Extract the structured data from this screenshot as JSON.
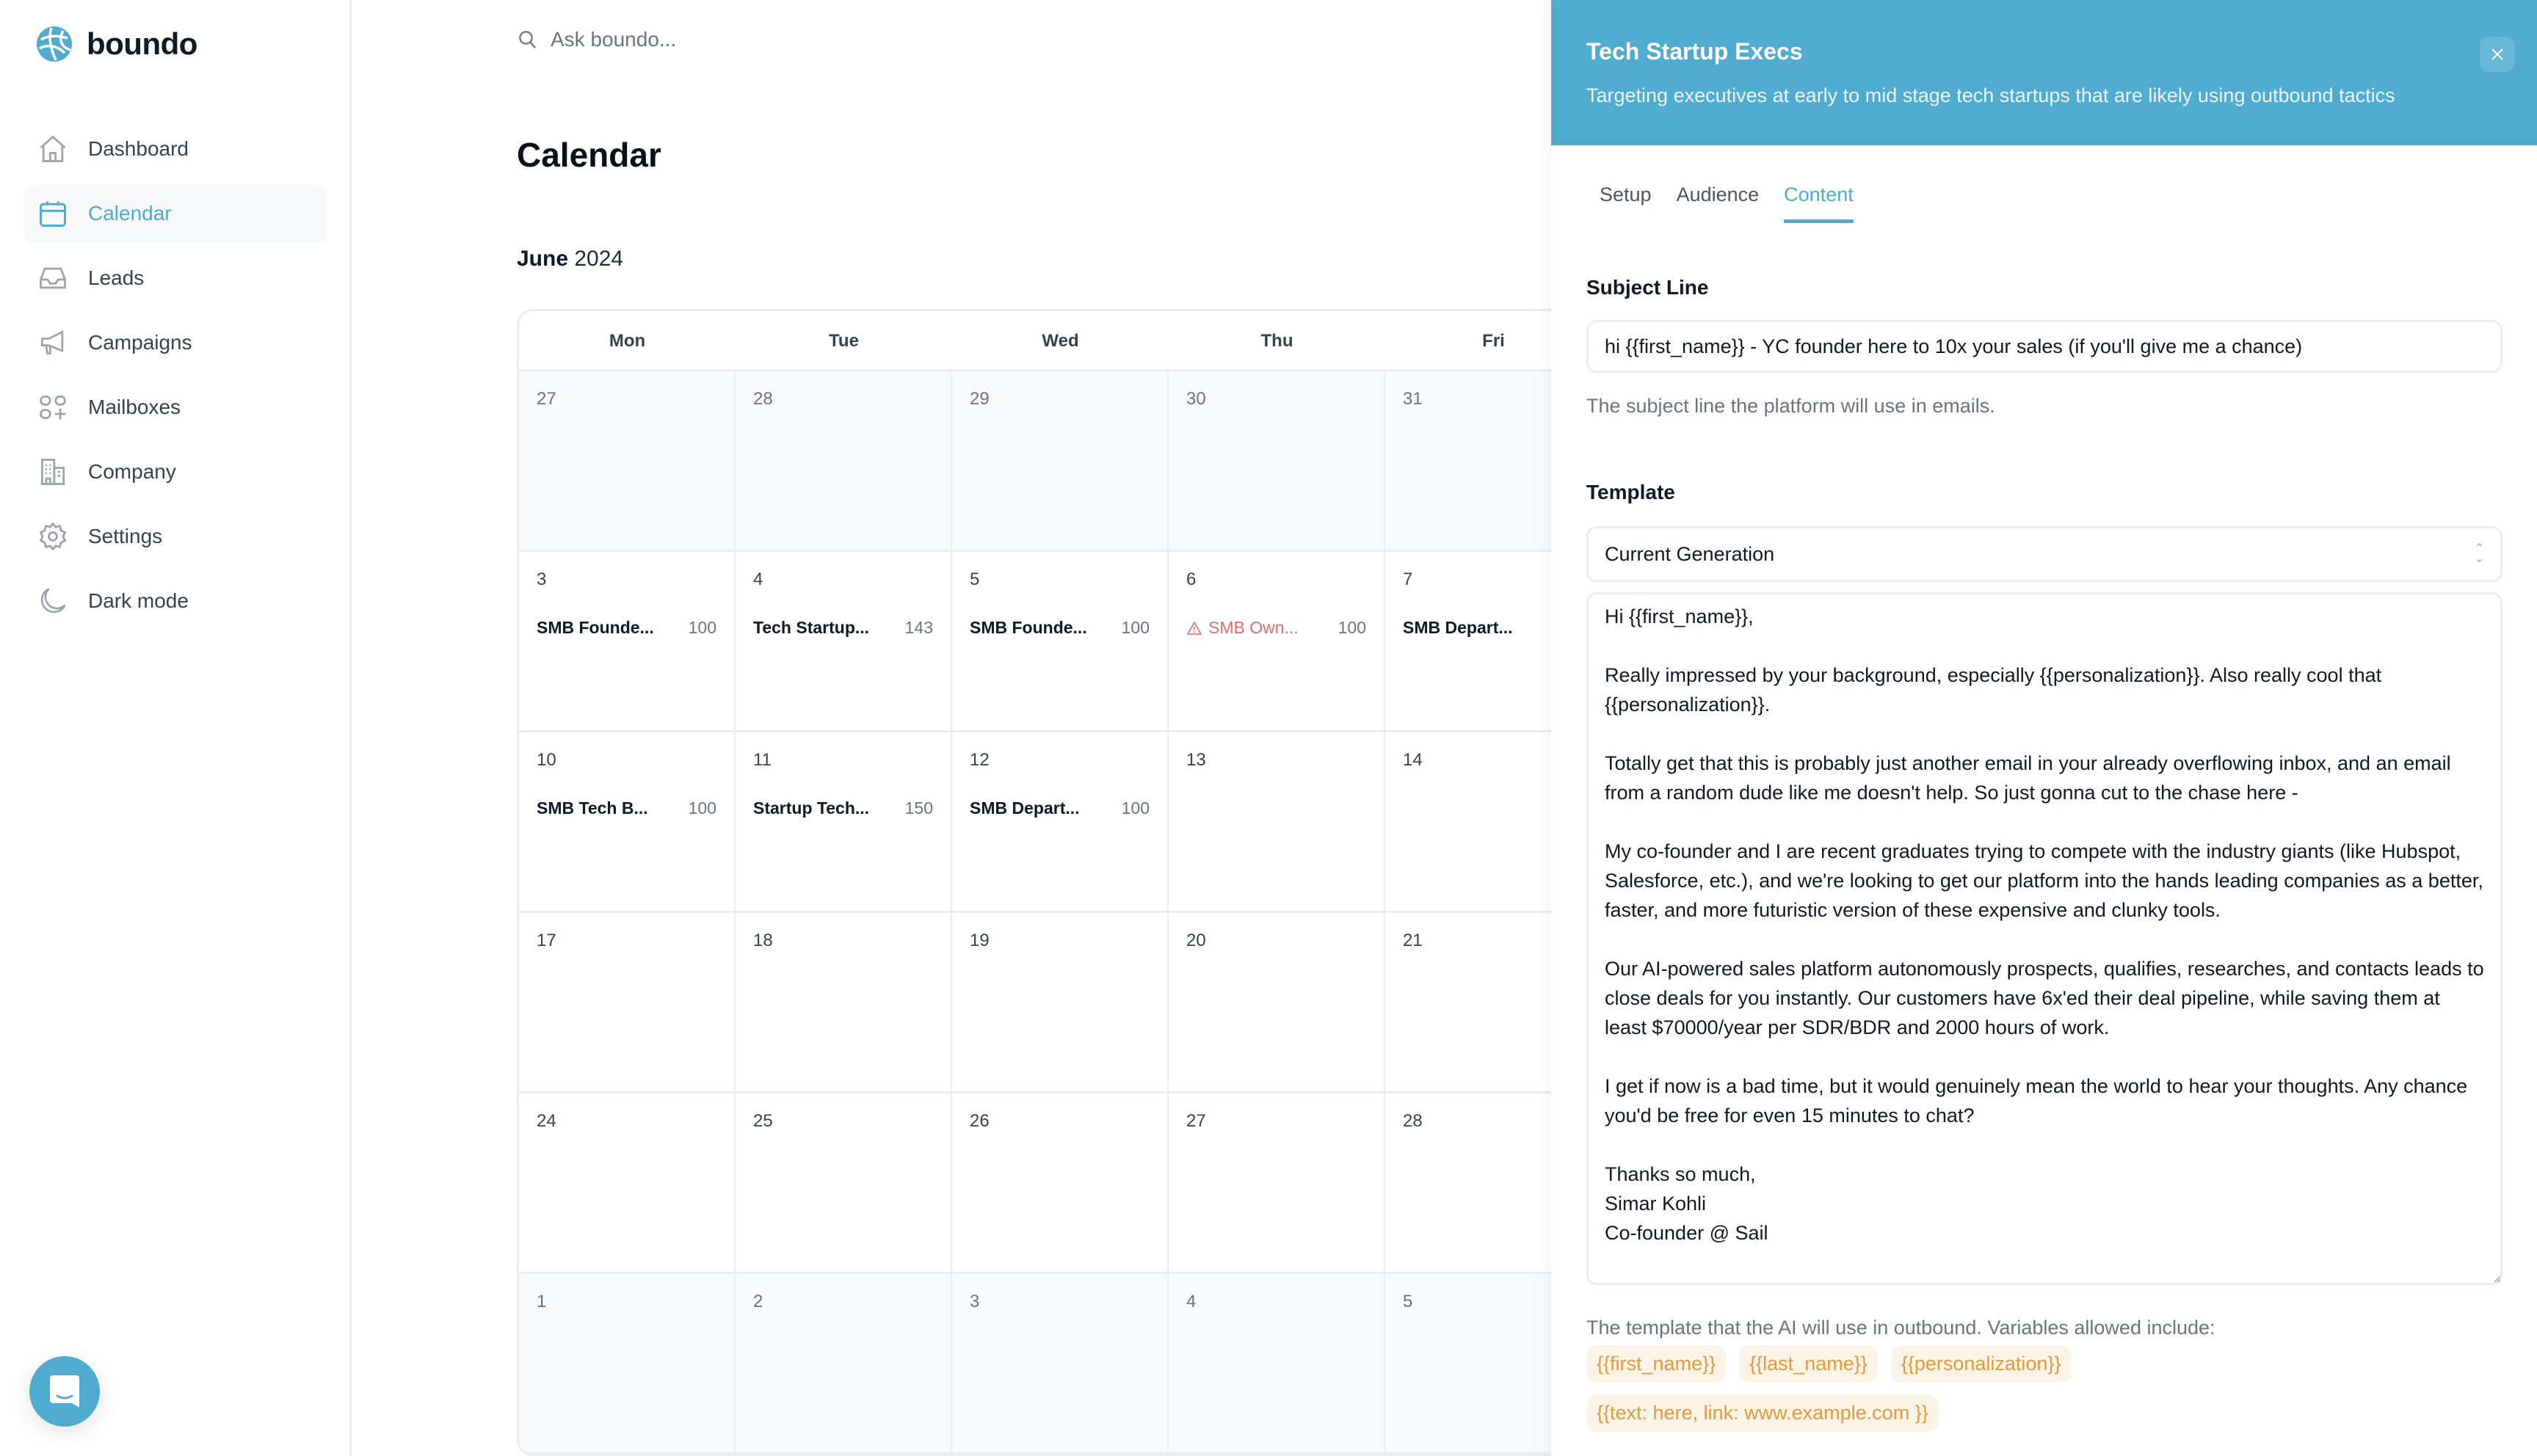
{
  "app": {
    "name": "boundo",
    "brand_color": "#4fabcf"
  },
  "sidebar": {
    "items": [
      {
        "label": "Dashboard",
        "icon": "home-icon",
        "active": false
      },
      {
        "label": "Calendar",
        "icon": "calendar-icon",
        "active": true
      },
      {
        "label": "Leads",
        "icon": "inbox-icon",
        "active": false
      },
      {
        "label": "Campaigns",
        "icon": "megaphone-icon",
        "active": false
      },
      {
        "label": "Mailboxes",
        "icon": "grid-plus-icon",
        "active": false
      },
      {
        "label": "Company",
        "icon": "building-icon",
        "active": false
      },
      {
        "label": "Settings",
        "icon": "gear-icon",
        "active": false
      },
      {
        "label": "Dark mode",
        "icon": "moon-icon",
        "active": false
      }
    ],
    "chat_button": {
      "icon": "chat-icon"
    }
  },
  "search": {
    "placeholder": "Ask boundo..."
  },
  "main": {
    "title": "Calendar",
    "month": "June",
    "year": "2024",
    "weekdays": [
      "Mon",
      "Tue",
      "Wed",
      "Thu",
      "Fri"
    ],
    "weeks": [
      {
        "muted": true,
        "days": [
          {
            "day": "27"
          },
          {
            "day": "28"
          },
          {
            "day": "29"
          },
          {
            "day": "30"
          },
          {
            "day": "31"
          }
        ]
      },
      {
        "muted": false,
        "days": [
          {
            "day": "3",
            "event": {
              "name": "SMB Founde...",
              "count": "100"
            }
          },
          {
            "day": "4",
            "event": {
              "name": "Tech Startup...",
              "count": "143"
            }
          },
          {
            "day": "5",
            "event": {
              "name": "SMB Founde...",
              "count": "100"
            }
          },
          {
            "day": "6",
            "event": {
              "name": "SMB Own...",
              "count": "100",
              "warning": true
            }
          },
          {
            "day": "7",
            "event": {
              "name": "SMB Depart...",
              "count": ""
            }
          }
        ]
      },
      {
        "muted": false,
        "days": [
          {
            "day": "10",
            "event": {
              "name": "SMB Tech B...",
              "count": "100"
            }
          },
          {
            "day": "11",
            "event": {
              "name": "Startup Tech...",
              "count": "150"
            }
          },
          {
            "day": "12",
            "event": {
              "name": "SMB Depart...",
              "count": "100"
            }
          },
          {
            "day": "13"
          },
          {
            "day": "14"
          }
        ]
      },
      {
        "muted": false,
        "days": [
          {
            "day": "17"
          },
          {
            "day": "18"
          },
          {
            "day": "19"
          },
          {
            "day": "20"
          },
          {
            "day": "21"
          }
        ]
      },
      {
        "muted": false,
        "days": [
          {
            "day": "24"
          },
          {
            "day": "25"
          },
          {
            "day": "26"
          },
          {
            "day": "27"
          },
          {
            "day": "28"
          }
        ]
      },
      {
        "muted": true,
        "days": [
          {
            "day": "1"
          },
          {
            "day": "2"
          },
          {
            "day": "3"
          },
          {
            "day": "4"
          },
          {
            "day": "5"
          }
        ]
      }
    ]
  },
  "panel": {
    "title": "Tech Startup Execs",
    "subtitle": "Targeting executives at early to mid stage tech startups that are likely using outbound tactics",
    "tabs": [
      {
        "label": "Setup",
        "active": false
      },
      {
        "label": "Audience",
        "active": false
      },
      {
        "label": "Content",
        "active": true
      }
    ],
    "subject": {
      "label": "Subject Line",
      "value": "hi {{first_name}} - YC founder here to 10x your sales (if you'll give me a chance)",
      "help": "The subject line the platform will use in emails."
    },
    "template": {
      "label": "Template",
      "selected": "Current Generation",
      "body": "Hi {{first_name}},\n\nReally impressed by your background, especially {{personalization}}. Also really cool that {{personalization}}.\n\nTotally get that this is probably just another email in your already overflowing inbox, and an email from a random dude like me doesn't help. So just gonna cut to the chase here -\n\nMy co-founder and I are recent graduates trying to compete with the industry giants (like Hubspot, Salesforce, etc.), and we're looking to get our platform into the hands leading companies as a better, faster, and more futuristic version of these expensive and clunky tools.\n\nOur AI-powered sales platform autonomously prospects, qualifies, researches, and contacts leads to close deals for you instantly. Our customers have 6x'ed their deal pipeline, while saving them at least $70000/year per SDR/BDR and 2000 hours of work.\n\nI get if now is a bad time, but it would genuinely mean the world to hear your thoughts. Any chance you'd be free for even 15 minutes to chat?\n\nThanks so much,\nSimar Kohli\nCo-founder @ Sail",
      "help": "The template that the AI will use in outbound. Variables allowed include:",
      "variables": [
        "{{first_name}}",
        "{{last_name}}",
        "{{personalization}}",
        "{{text: here, link: www.example.com }}"
      ]
    }
  }
}
